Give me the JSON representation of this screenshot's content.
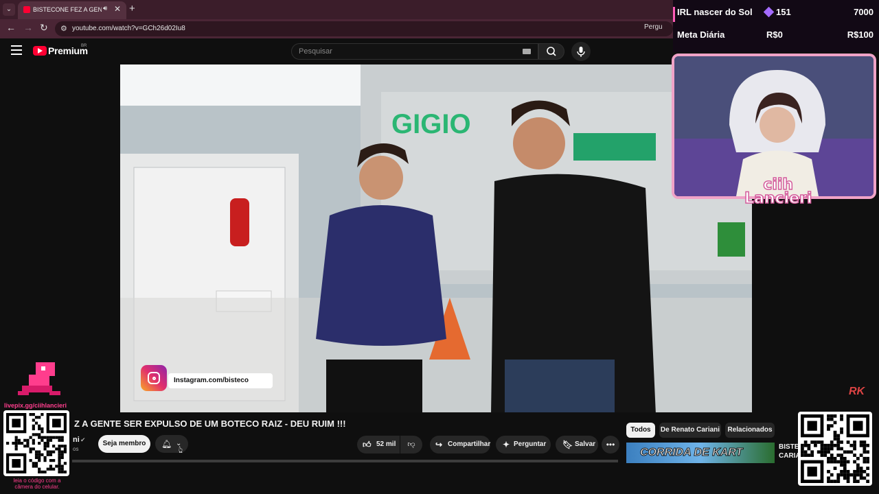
{
  "browser": {
    "tab_title": "BISTECONE FEZ A GENTE SE",
    "url": "youtube.com/watch?v=GCh26d02Iu8",
    "ask_chip_label": "Pergu"
  },
  "youtube": {
    "logo_text": "Premium",
    "country_code": "BR",
    "search_placeholder": "Pesquisar"
  },
  "video": {
    "instagram_handle": "Instagram.com/bisteco",
    "title": "A GENTE SER EXPULSO DE UM BOTECO RAIZ - DEU RUIM !!!",
    "title_prefix": "Z",
    "channel_name_fragment": "ni",
    "subs_fragment": "os",
    "join_label": "Seja membro",
    "like_count": "52 mil",
    "share_label": "Compartilhar",
    "ask_label": "Perguntar",
    "save_label": "Salvar"
  },
  "recommendations": {
    "chips": [
      "Todos",
      "De Renato Cariani",
      "Relacionados"
    ],
    "thumb_text": "CORRIDA DE KART",
    "title_snippet": "BISTEC CARIA"
  },
  "stream_overlay": {
    "goals": [
      {
        "label": "IRL nascer do Sol",
        "current": "151",
        "target": "7000"
      },
      {
        "label": "Meta Diária",
        "current": "R$0",
        "target": "R$100"
      }
    ],
    "streamer_name_line1": "ciih",
    "streamer_name_line2": "Lancieri",
    "livepix_label": "livepix.gg/ciihlancieri",
    "qr_hint": "leia o código com a câmera do celular.",
    "watermark": "RK"
  },
  "colors": {
    "accent_pink": "#ff5cb8",
    "yt_red": "#ff0033",
    "browser_tab_bg": "#3b1d2a"
  }
}
